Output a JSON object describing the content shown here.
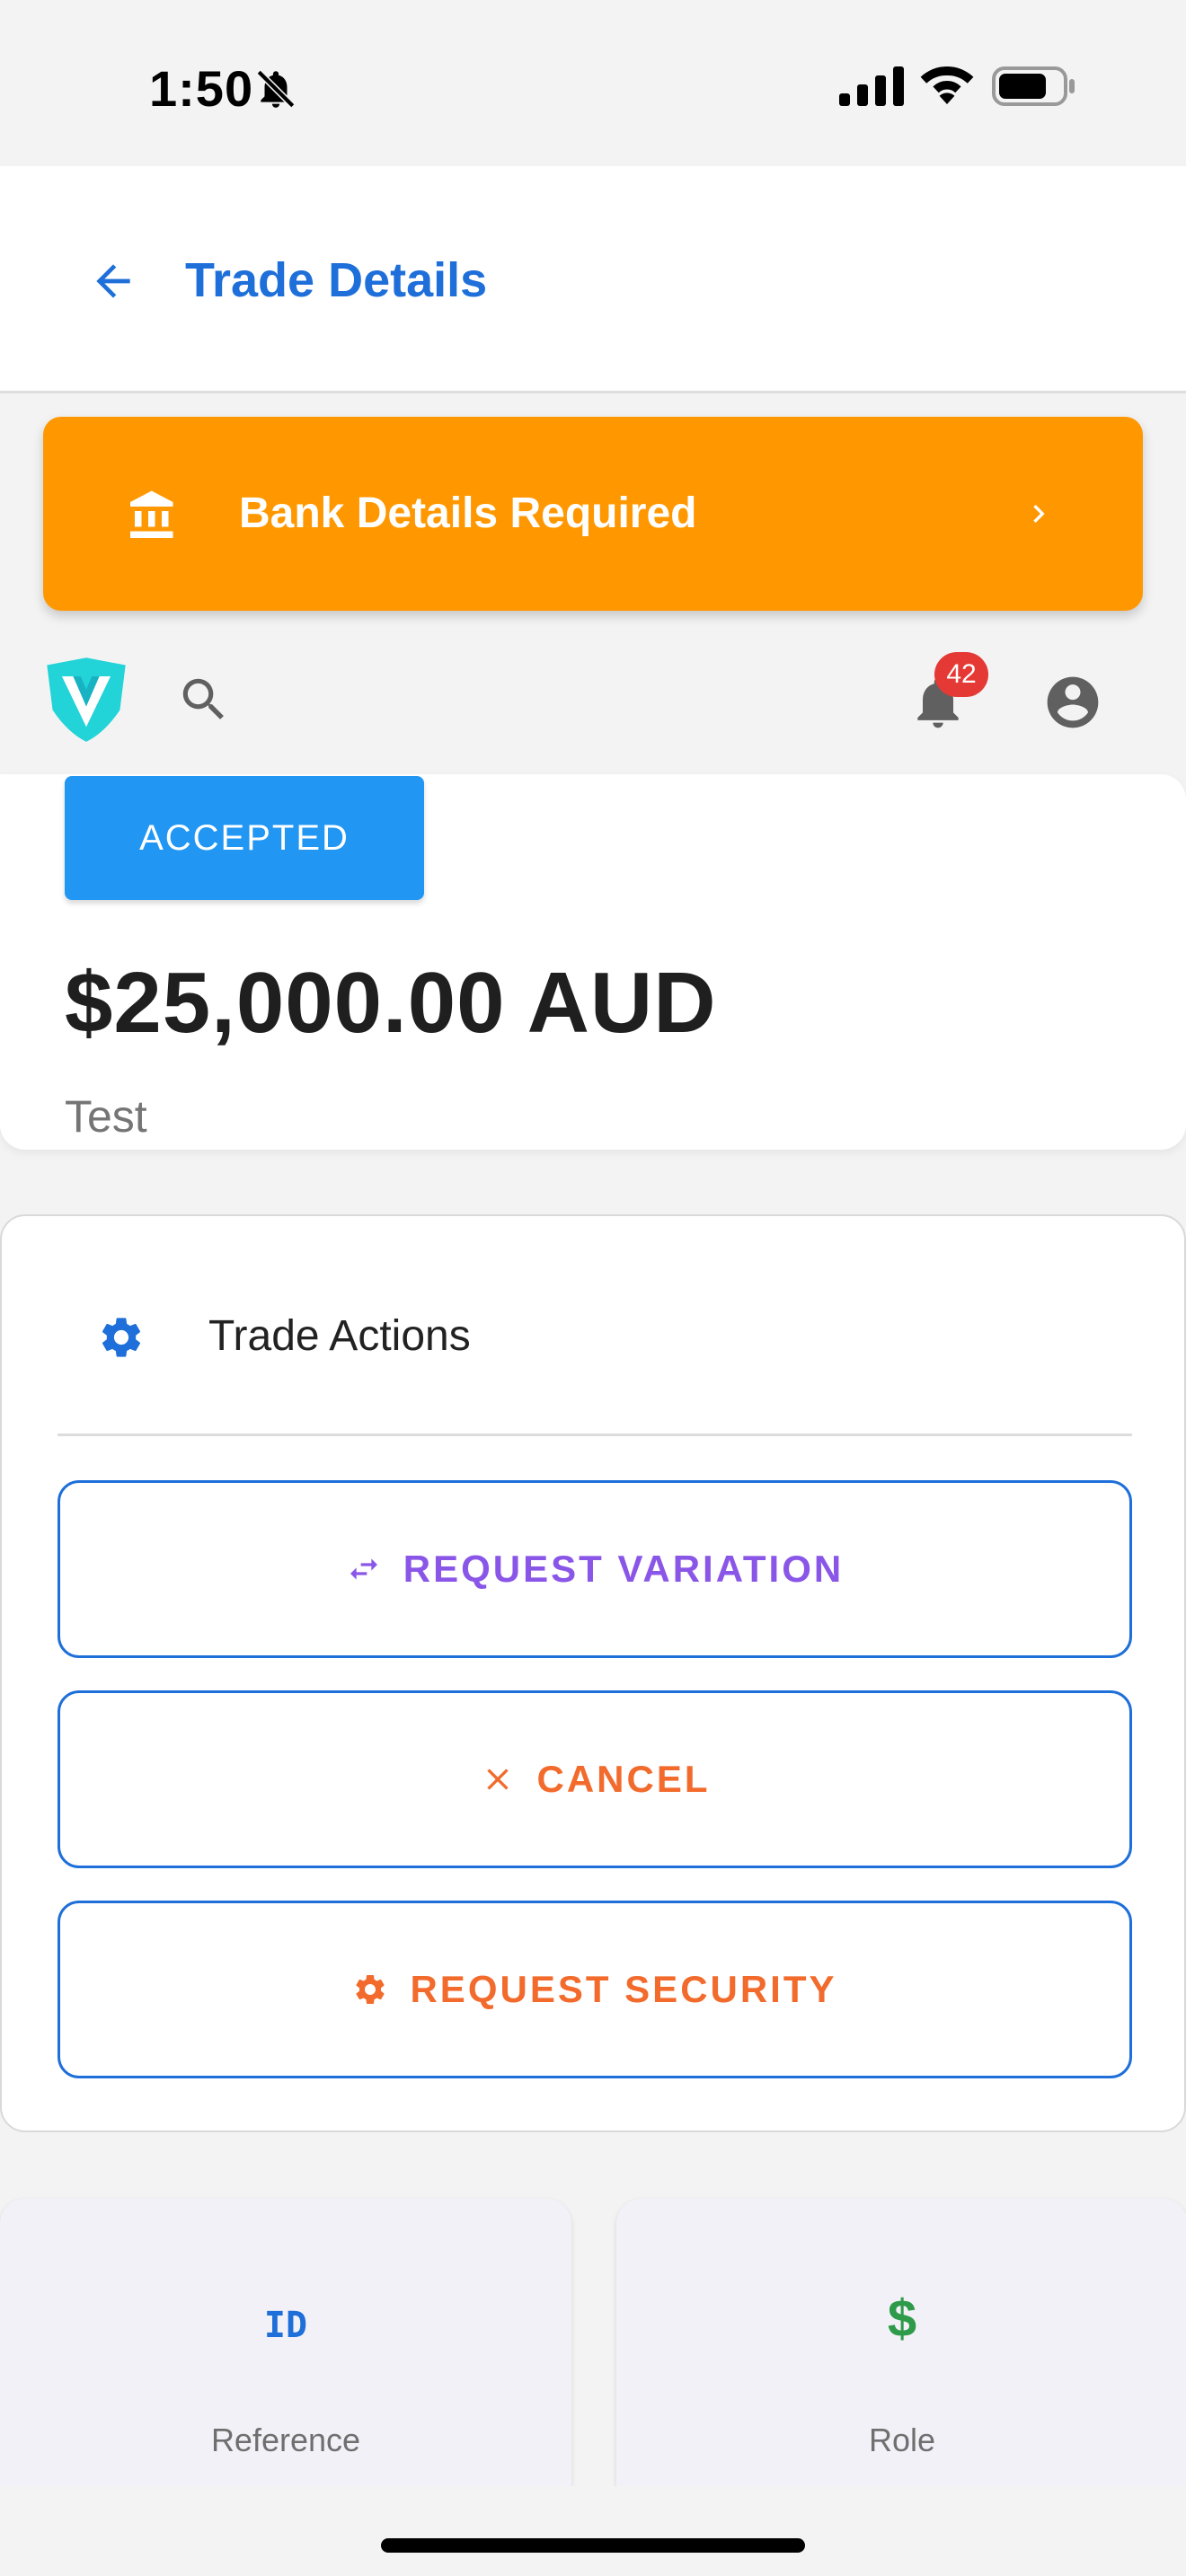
{
  "status_bar": {
    "time": "1:50"
  },
  "app_bar": {
    "title": "Trade Details"
  },
  "banner": {
    "label": "Bank Details Required"
  },
  "nav": {
    "notification_count": "42"
  },
  "trade": {
    "status": "ACCEPTED",
    "amount": "$25,000.00 AUD",
    "description": "Test"
  },
  "actions": {
    "title": "Trade Actions",
    "buttons": [
      {
        "label": "REQUEST VARIATION",
        "icon": "swap-horiz-icon",
        "color": "#8a56e8"
      },
      {
        "label": "CANCEL",
        "icon": "close-icon",
        "color": "#f26b2d"
      },
      {
        "label": "REQUEST SECURITY",
        "icon": "gear-icon",
        "color": "#f26b2d"
      }
    ]
  },
  "info_cards": [
    {
      "icon_text": "ID",
      "label": "Reference"
    },
    {
      "icon_text": "$",
      "label": "Role"
    }
  ],
  "colors": {
    "primary": "#1e6fd9",
    "banner": "#ff9800",
    "status_chip": "#2196f3",
    "badge": "#e53935"
  }
}
